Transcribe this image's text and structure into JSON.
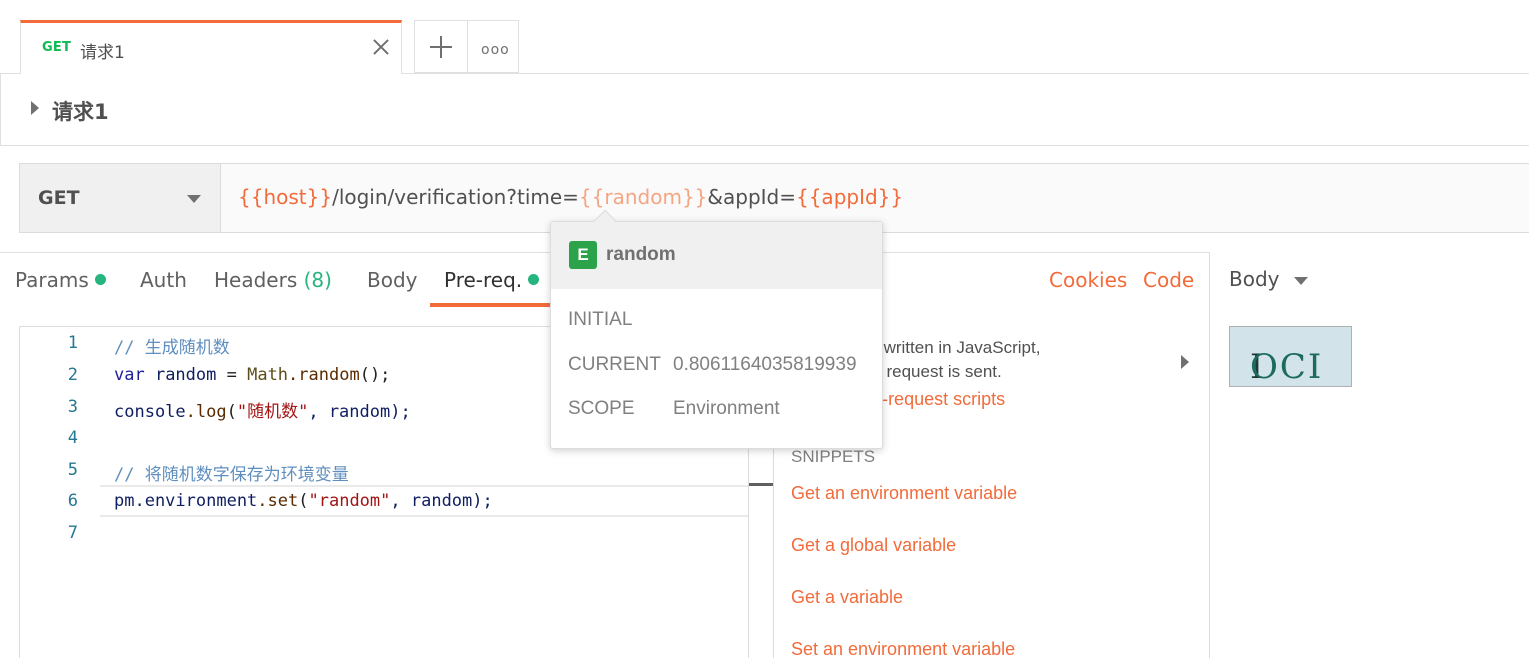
{
  "tabs": {
    "active": {
      "method": "GET",
      "title": "请求1"
    },
    "more_label": "ooo"
  },
  "request": {
    "name": "请求1",
    "method": "GET",
    "url": {
      "var_host": "{{host}}",
      "path": "/login/verification?time=",
      "var_random": "{{random}}",
      "mid": "&appId=",
      "var_appid": "{{appId}}"
    }
  },
  "subtabs": {
    "params": "Params",
    "auth": "Auth",
    "headers": "Headers",
    "headers_count": "(8)",
    "body": "Body",
    "prereq": "Pre-req.",
    "cookies": "Cookies",
    "code": "Code"
  },
  "editor": {
    "line_numbers": [
      "1",
      "2",
      "3",
      "4",
      "5",
      "6",
      "7"
    ],
    "line1": "// 生成随机数",
    "line2_kw": "var",
    "line2_var": " random ",
    "line2_eq": "= ",
    "line2_cls": "Math",
    "line2_fn": ".random",
    "line2_end": "();",
    "line3_a": "console",
    "line3_fn": ".log",
    "line3_p": "(",
    "line3_str": "\"随机数\"",
    "line3_end": ", random);",
    "line5": "// 将随机数字保存为环境变量",
    "line6_a": "pm.environment",
    "line6_fn": ".set",
    "line6_p": "(",
    "line6_str": "\"random\"",
    "line6_end": ", random);"
  },
  "help": {
    "text_line1": "t scripts are written in JavaScript,",
    "text_line2": "n before the request is sent.",
    "link": "e about pre-request scripts",
    "snippets_header": "SNIPPETS",
    "snippets": [
      "Get an environment variable",
      "Get a global variable",
      "Get a variable",
      "Set an environment variable"
    ]
  },
  "response": {
    "body_label": "Body",
    "captcha_text_a": "I ",
    "captcha_text_b": "OCI"
  },
  "tooltip": {
    "badge": "E",
    "name": "random",
    "initial_label": "INITIAL",
    "initial_value": "",
    "current_label": "CURRENT",
    "current_value": "0.8061164035819939",
    "scope_label": "SCOPE",
    "scope_value": "Environment"
  }
}
